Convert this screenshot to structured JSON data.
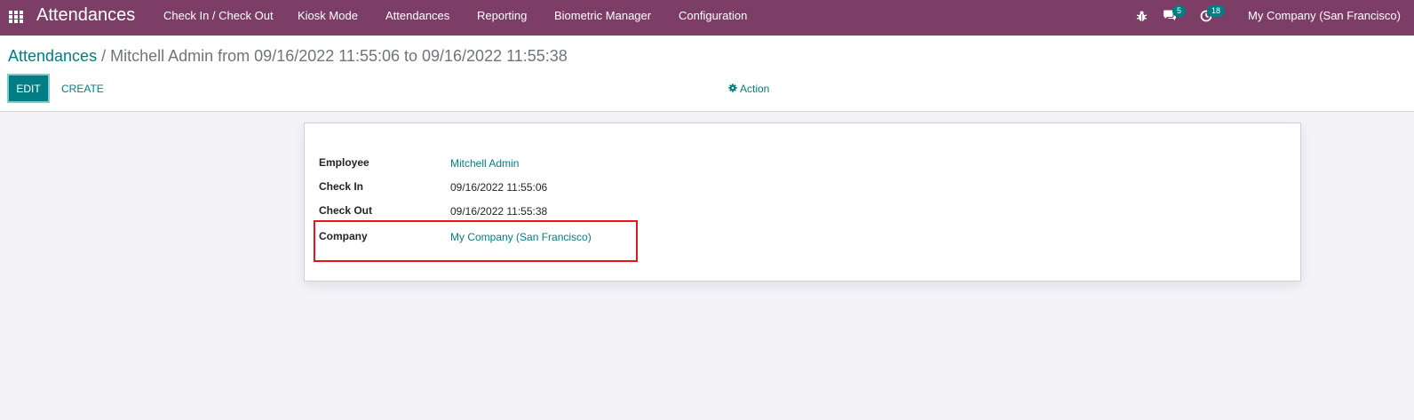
{
  "navbar": {
    "brand": "Attendances",
    "menu": [
      "Check In / Check Out",
      "Kiosk Mode",
      "Attendances",
      "Reporting",
      "Biometric Manager",
      "Configuration"
    ],
    "messages_count": "5",
    "activities_count": "18",
    "company": "My Company (San Francisco)"
  },
  "breadcrumb": {
    "parent": "Attendances",
    "separator": "/",
    "current": "Mitchell Admin from 09/16/2022 11:55:06 to 09/16/2022 11:55:38"
  },
  "buttons": {
    "edit": "EDIT",
    "create": "CREATE",
    "action": "Action"
  },
  "form": {
    "fields": [
      {
        "label": "Employee",
        "value": "Mitchell Admin"
      },
      {
        "label": "Check In",
        "value": "09/16/2022 11:55:06"
      },
      {
        "label": "Check Out",
        "value": "09/16/2022 11:55:38"
      },
      {
        "label": "Company",
        "value": "My Company (San Francisco)"
      }
    ]
  },
  "colors": {
    "navbar": "#7c3d66",
    "primary": "#017e84",
    "highlight": "#e8141b"
  }
}
